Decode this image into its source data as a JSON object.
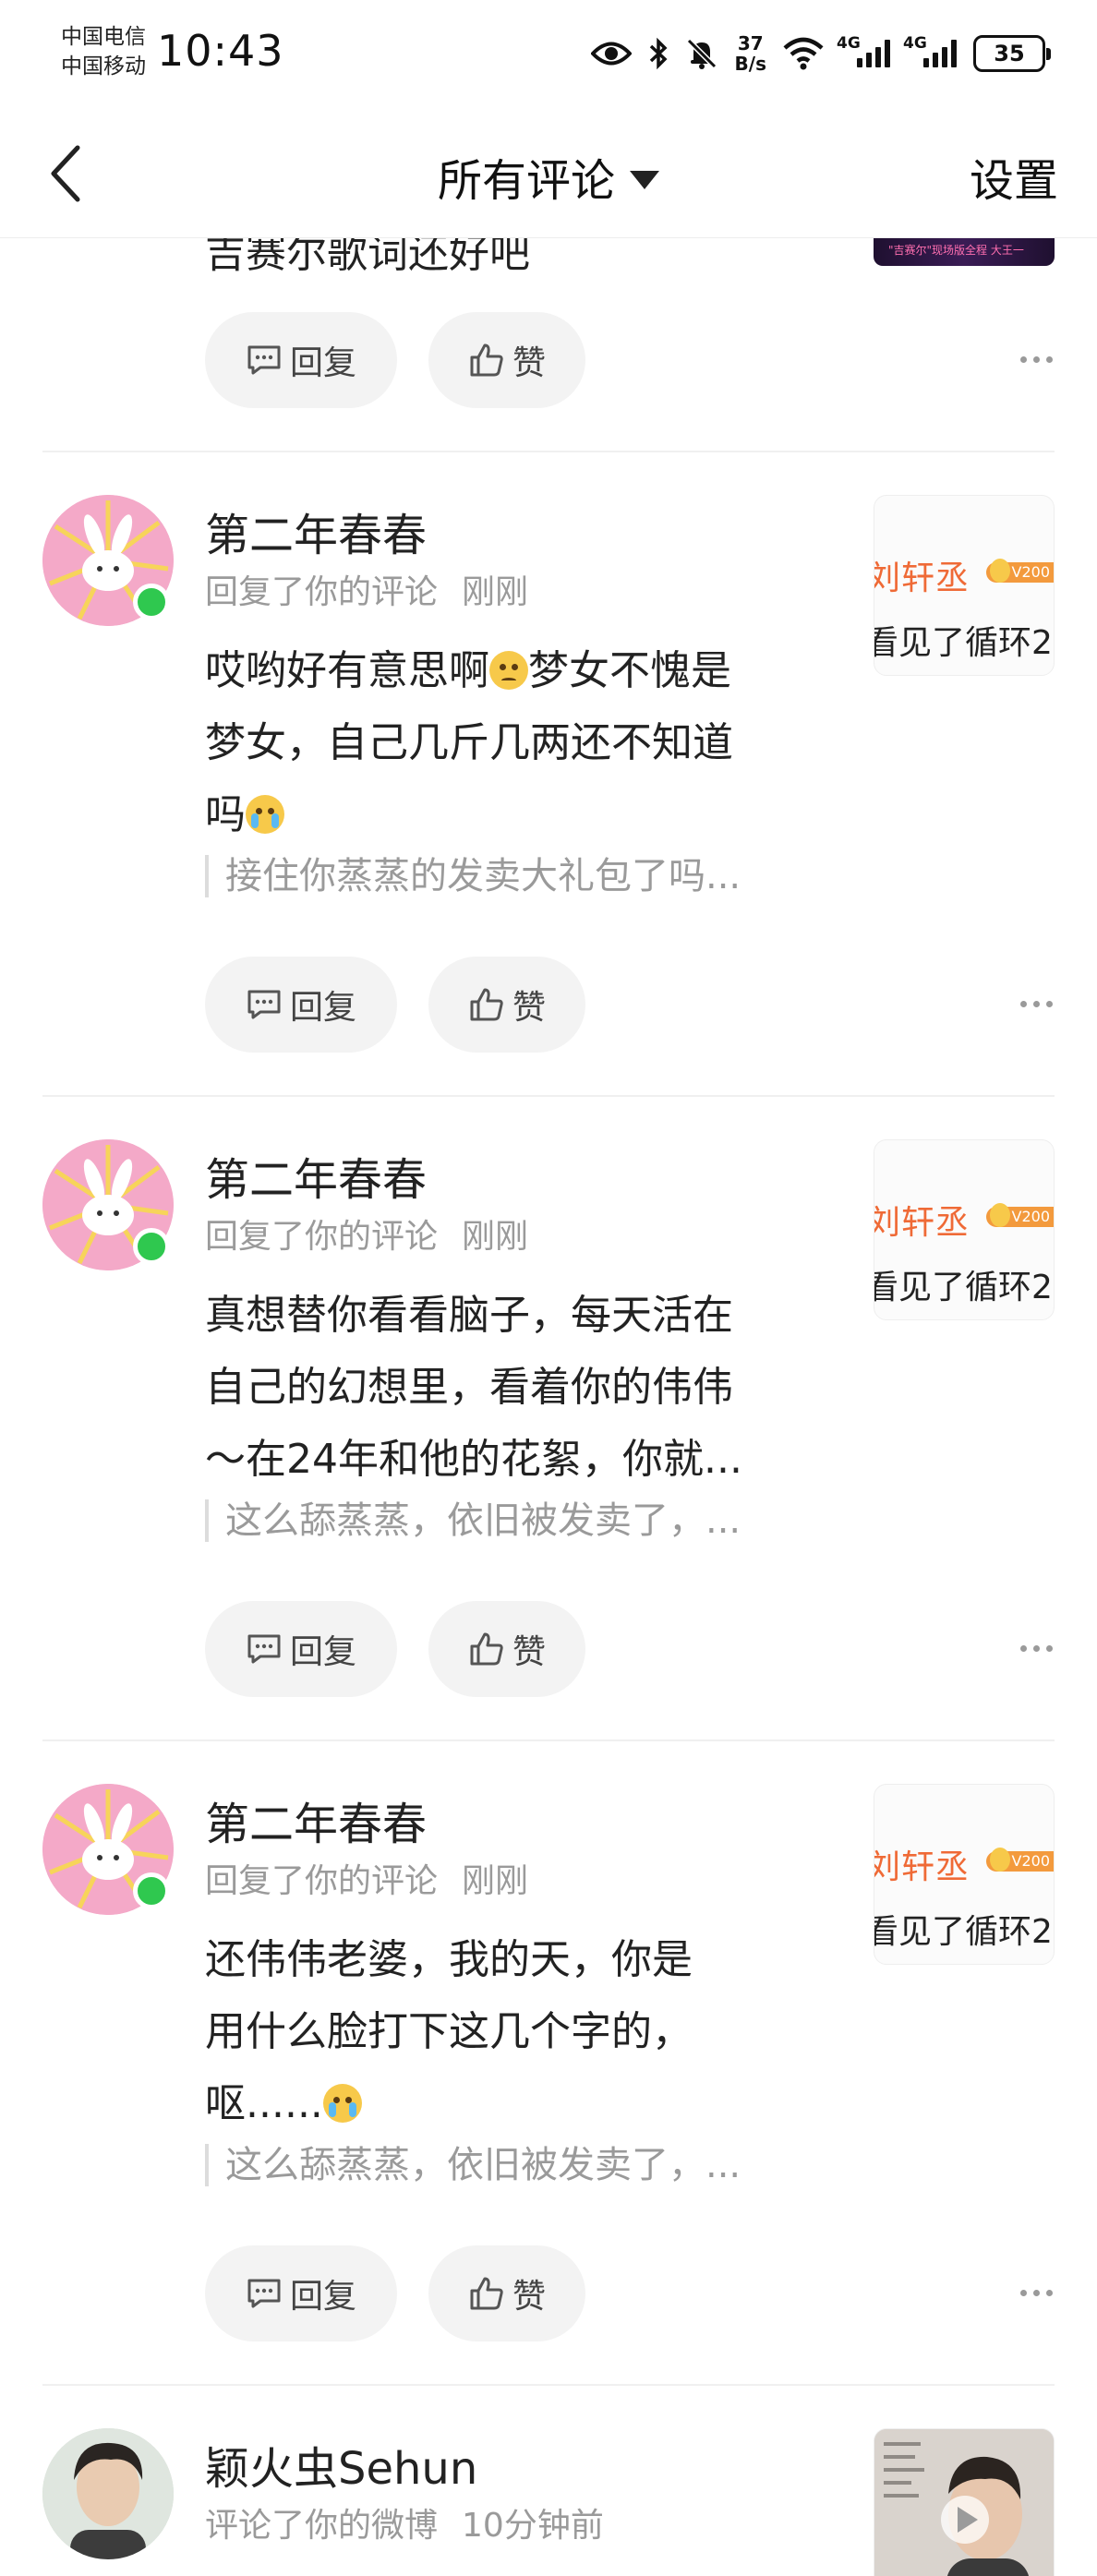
{
  "status_bar": {
    "carrier_1": "中国电信",
    "carrier_2": "中国移动",
    "time": "10:43",
    "net_speed_value": "37",
    "net_speed_unit": "B/s",
    "sim1_type": "4G",
    "sim2_type": "4G",
    "battery": "35"
  },
  "nav": {
    "title": "所有评论",
    "settings_label": "设置"
  },
  "partial_item": {
    "text": "吉赛尔歌词还好吧",
    "thumb_caption": "\"吉赛尔\"现场版全程 大王一"
  },
  "actions": {
    "reply_label": "回复",
    "like_label": "赞"
  },
  "notifications": [
    {
      "username": "第二年春春",
      "action": "回复了你的评论",
      "time": "刚刚",
      "body_lines": [
        "哎哟好有意思啊",
        "梦女不愧是",
        "梦女，自己几斤几两还不知道",
        "吗"
      ],
      "quote": "接住你蒸蒸的发卖大礼包了吗...",
      "thumb_line1": "刘轩丞",
      "thumb_badge": "V200",
      "thumb_line2": "看见了循环2"
    },
    {
      "username": "第二年春春",
      "action": "回复了你的评论",
      "time": "刚刚",
      "body_lines": [
        "真想替你看看脑子，每天活在",
        "自己的幻想里，看着你的伟伟",
        "～在24年和他的花絮，你就..."
      ],
      "quote": "这么舔蒸蒸，依旧被发卖了，...",
      "thumb_line1": "刘轩丞",
      "thumb_badge": "V200",
      "thumb_line2": "看见了循环2"
    },
    {
      "username": "第二年春春",
      "action": "回复了你的评论",
      "time": "刚刚",
      "body_lines": [
        "还伟伟老婆，我的天，你是",
        "用什么脸打下这几个字的，",
        "呕......"
      ],
      "quote": "这么舔蒸蒸，依旧被发卖了，...",
      "thumb_line1": "刘轩丞",
      "thumb_badge": "V200",
      "thumb_line2": "看见了循环2"
    },
    {
      "username": "颖火虫Sehun",
      "action": "评论了你的微博",
      "time": "10分钟前"
    }
  ],
  "colors": {
    "online_dot": "#2fc84f",
    "meta_gray": "#9a9a9a",
    "pill_bg": "#f3f3f3",
    "thumb_orange": "#ef6a36"
  }
}
